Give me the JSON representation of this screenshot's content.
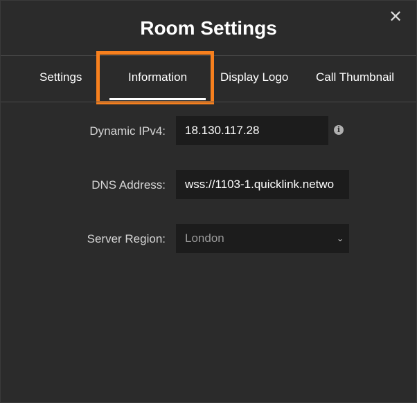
{
  "dialog": {
    "title": "Room Settings",
    "close_glyph": "✕"
  },
  "tabs": [
    {
      "label": "Settings"
    },
    {
      "label": "Information"
    },
    {
      "label": "Display Logo"
    },
    {
      "label": "Call Thumbnail"
    }
  ],
  "active_tab": "Information",
  "form": {
    "ipv4_label": "Dynamic IPv4:",
    "ipv4_value": "18.130.117.28",
    "dns_label": "DNS Address:",
    "dns_value": "wss://1103-1.quicklink.netwo",
    "region_label": "Server Region:",
    "region_value": "London"
  },
  "icons": {
    "info": "i",
    "chevron": "⌄"
  },
  "colors": {
    "background": "#2b2b2b",
    "field_background": "#1c1c1c",
    "highlight": "#f7801e"
  }
}
